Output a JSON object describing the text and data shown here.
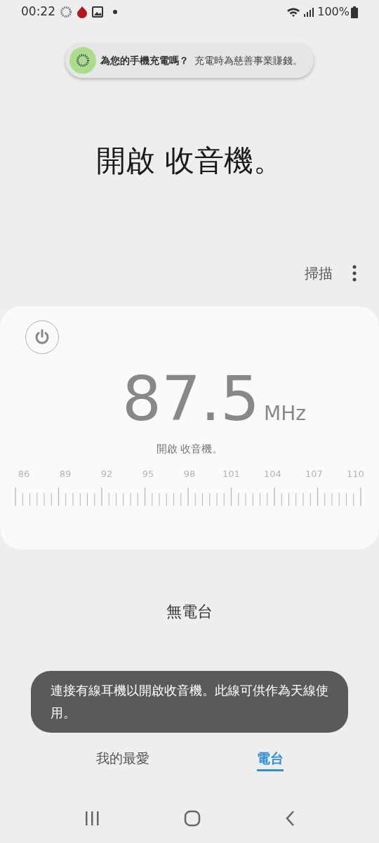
{
  "status_bar": {
    "time": "00:22",
    "battery": "100%"
  },
  "notification": {
    "title": "為您的手機充電嗎？",
    "text": "充電時為慈善事業賺錢。"
  },
  "headline": "開啟 收音機。",
  "toolbar": {
    "scan": "掃描"
  },
  "tuner": {
    "on": false,
    "frequency": "87.5",
    "unit": "MHz",
    "status": "開啟 收音機。",
    "scale": [
      "86",
      "89",
      "92",
      "95",
      "98",
      "101",
      "104",
      "107",
      "110"
    ]
  },
  "empty_state": {
    "title": "無電台"
  },
  "toast": "連接有線耳機以開啟收音機。此線可供作為天線使用。",
  "tabs": [
    {
      "label": "我的最愛",
      "selected": false
    },
    {
      "label": "電台",
      "selected": true
    }
  ]
}
